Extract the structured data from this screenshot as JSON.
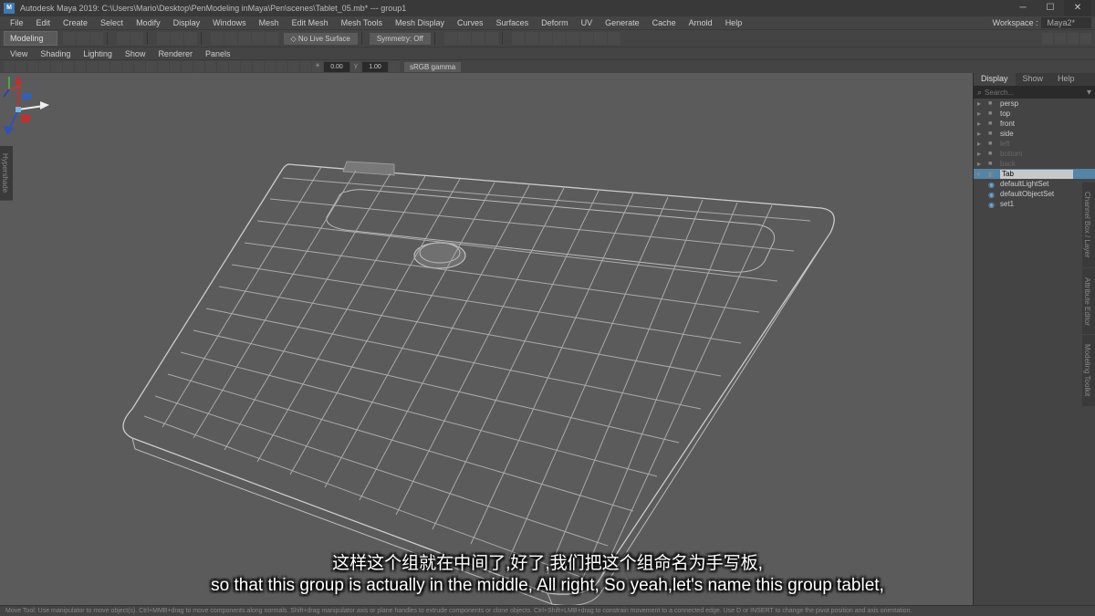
{
  "titlebar": {
    "app_icon_text": "M",
    "title": "Autodesk Maya 2019: C:\\Users\\Mario\\Desktop\\PenModeling inMaya\\Pen\\scenes\\Tablet_05.mb*  ---  group1"
  },
  "menubar": {
    "items": [
      "File",
      "Edit",
      "Create",
      "Select",
      "Modify",
      "Display",
      "Windows",
      "Mesh",
      "Edit Mesh",
      "Mesh Tools",
      "Mesh Display",
      "Curves",
      "Surfaces",
      "Deform",
      "UV",
      "Generate",
      "Cache",
      "Arnold",
      "Help"
    ],
    "workspace_label": "Workspace :",
    "workspace_value": "Maya2*"
  },
  "toolbar": {
    "mode": "Modeling",
    "live_surface": "No Live Surface",
    "symmetry": "Symmetry: Off"
  },
  "panel_menu": {
    "items": [
      "View",
      "Shading",
      "Lighting",
      "Show",
      "Renderer",
      "Panels"
    ]
  },
  "panel_toolbar": {
    "val1": "0.00",
    "val2": "1.00",
    "renderer": "sRGB gamma"
  },
  "outliner": {
    "tabs": [
      "Display",
      "Show",
      "Help"
    ],
    "search_placeholder": "Search...",
    "items": [
      {
        "icon": "cam",
        "label": "persp",
        "expand": true
      },
      {
        "icon": "cam",
        "label": "top",
        "expand": true
      },
      {
        "icon": "cam",
        "label": "front",
        "expand": true
      },
      {
        "icon": "cam",
        "label": "side",
        "expand": true
      },
      {
        "icon": "cam",
        "label": "left",
        "dim": true,
        "expand": true
      },
      {
        "icon": "cam",
        "label": "bottom",
        "dim": true,
        "expand": true
      },
      {
        "icon": "cam",
        "label": "back",
        "dim": true,
        "expand": true
      }
    ],
    "selected_edit_value": "Tab",
    "sets": [
      {
        "label": "defaultLightSet"
      },
      {
        "label": "defaultObjectSet"
      },
      {
        "label": "set1"
      }
    ]
  },
  "statusbar": {
    "text": "Move Tool: Use manipulator to move object(s). Ctrl+MMB+drag to move components along normals. Shift+drag manipulator axis or plane handles to extrude components or clone objects. Ctrl+Shift+LMB+drag to constrain movement to a connected edge. Use D or INSERT to change the pivot position and axis orientation."
  },
  "subtitle": {
    "cn": "这样这个组就在中间了,好了,我们把这个组命名为手写板,",
    "en": "so that this group is actually in the middle, All right, So yeah,let's name this group tablet,"
  },
  "side_tabs_right": [
    "Channel Box / Layer",
    "Attribute Editor",
    "Modeling Toolkit"
  ],
  "side_tabs_left": [
    "Hypershade"
  ]
}
